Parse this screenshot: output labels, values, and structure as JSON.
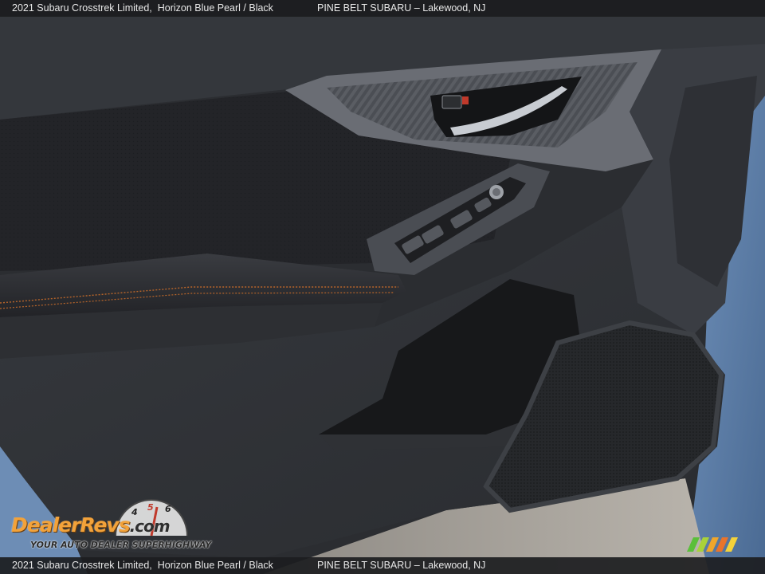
{
  "caption": {
    "vehicle": "2021 Subaru Crosstrek Limited,",
    "color_trim": "Horizon Blue Pearl / Black",
    "dealer": "PINE BELT SUBARU – Lakewood, NJ"
  },
  "watermark": {
    "brand_part1": "Dealer",
    "brand_part2": "Revs",
    "brand_part3": ".com",
    "tagline": "YOUR AUTO DEALER SUPERHIGHWAY",
    "gauge_digits": [
      "4",
      "5",
      "6"
    ]
  },
  "colors": {
    "door_panel": "#2a2c30",
    "door_trim": "#3b3e44",
    "body_paint": "#5d7fa8",
    "stitching": "#b8652a",
    "watermark_orange": "#f2a23a"
  }
}
